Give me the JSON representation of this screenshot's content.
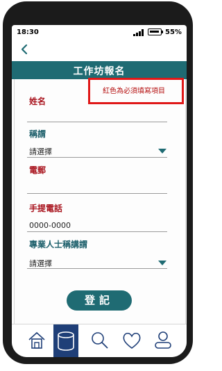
{
  "status_bar": {
    "time": "18:30",
    "battery": "55%"
  },
  "header": {
    "title": "工作坊報名"
  },
  "required_note": "紅色為必須填寫項目",
  "form": {
    "name_label": "姓名",
    "salutation_label": "稱謂",
    "salutation_value": "請選擇",
    "email_label": "電郵",
    "mobile_label": "手提電話",
    "mobile_placeholder": "0000-0000",
    "title_label": "專業人士稱講謂",
    "title_value": "請選擇",
    "submit_label": "登記"
  },
  "tabbar": {
    "items": [
      "home-icon",
      "database-icon",
      "search-icon",
      "heart-icon",
      "user-icon"
    ],
    "active_index": 1
  },
  "colors": {
    "accent": "#1f6b73",
    "required": "#a8121c",
    "active_tab": "#1f3f78",
    "highlight_box": "#e01818"
  }
}
